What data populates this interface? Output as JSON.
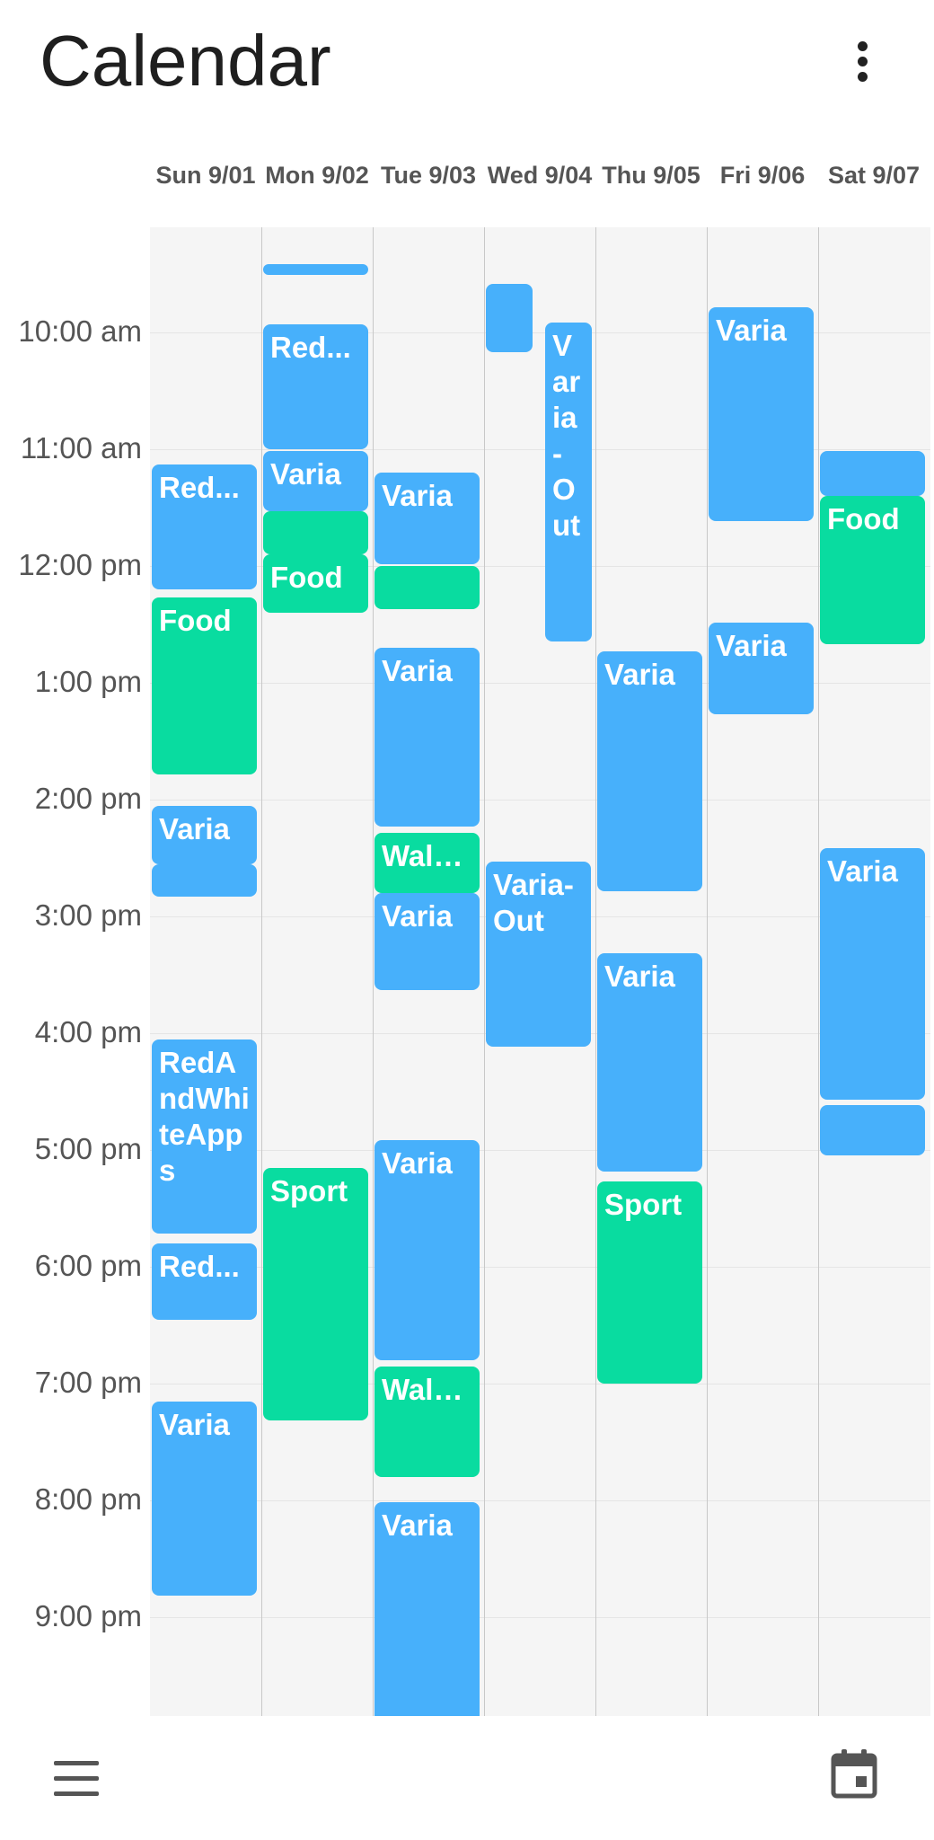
{
  "app": {
    "title": "Calendar"
  },
  "days": [
    "Sun 9/01",
    "Mon 9/02",
    "Tue 9/03",
    "Wed 9/04",
    "Thu 9/05",
    "Fri 9/06",
    "Sat 9/07"
  ],
  "times": [
    "10:00 am",
    "11:00 am",
    "12:00 pm",
    "1:00 pm",
    "2:00 pm",
    "3:00 pm",
    "4:00 pm",
    "5:00 pm",
    "6:00 pm",
    "7:00 pm",
    "8:00 pm",
    "9:00 pm",
    "10:00 pm"
  ],
  "colors": {
    "varia": "#47b0fb",
    "green": "#09dca0"
  },
  "events": [
    {
      "day": 0,
      "start": "11:08",
      "end": "12:12",
      "label": "Red...",
      "kind": "varia"
    },
    {
      "day": 0,
      "start": "12:16",
      "end": "13:47",
      "label": "Food",
      "kind": "green"
    },
    {
      "day": 0,
      "start": "14:03",
      "end": "14:33",
      "label": "Varia",
      "kind": "varia"
    },
    {
      "day": 0,
      "start": "14:33",
      "end": "14:50",
      "label": "",
      "kind": "varia"
    },
    {
      "day": 0,
      "start": "16:03",
      "end": "17:43",
      "label": "RedAndWhiteApps",
      "kind": "varia"
    },
    {
      "day": 0,
      "start": "17:48",
      "end": "18:27",
      "label": "Red...",
      "kind": "varia"
    },
    {
      "day": 0,
      "start": "19:09",
      "end": "20:49",
      "label": "Varia",
      "kind": "varia"
    },
    {
      "day": 1,
      "start": "09:25",
      "end": "09:28",
      "label": "",
      "kind": "varia"
    },
    {
      "day": 1,
      "start": "09:56",
      "end": "11:00",
      "label": "Red...",
      "kind": "varia"
    },
    {
      "day": 1,
      "start": "11:01",
      "end": "11:32",
      "label": "Varia",
      "kind": "varia"
    },
    {
      "day": 1,
      "start": "11:32",
      "end": "11:54",
      "label": "",
      "kind": "green"
    },
    {
      "day": 1,
      "start": "11:54",
      "end": "12:24",
      "label": "Food",
      "kind": "green"
    },
    {
      "day": 1,
      "start": "17:09",
      "end": "19:19",
      "label": "Sport",
      "kind": "green"
    },
    {
      "day": 2,
      "start": "11:12",
      "end": "11:59",
      "label": "Varia",
      "kind": "varia"
    },
    {
      "day": 2,
      "start": "12:00",
      "end": "12:22",
      "label": "",
      "kind": "green"
    },
    {
      "day": 2,
      "start": "12:42",
      "end": "14:14",
      "label": "Varia",
      "kind": "varia"
    },
    {
      "day": 2,
      "start": "14:17",
      "end": "14:48",
      "label": "Walk...",
      "kind": "green"
    },
    {
      "day": 2,
      "start": "14:48",
      "end": "15:38",
      "label": "Varia",
      "kind": "varia"
    },
    {
      "day": 2,
      "start": "16:55",
      "end": "18:48",
      "label": "Varia",
      "kind": "varia"
    },
    {
      "day": 2,
      "start": "18:51",
      "end": "19:48",
      "label": "Walking",
      "kind": "green"
    },
    {
      "day": 2,
      "start": "20:01",
      "end": "21:56",
      "label": "Varia",
      "kind": "varia"
    },
    {
      "day": 3,
      "start": "09:35",
      "end": "10:10",
      "label": "",
      "kind": "varia"
    },
    {
      "day": 3,
      "start": "09:55",
      "end": "12:39",
      "label": "Varia-Out",
      "kind": "varia"
    },
    {
      "day": 3,
      "start": "14:32",
      "end": "16:07",
      "label": "Varia-Out",
      "kind": "varia"
    },
    {
      "day": 4,
      "start": "12:44",
      "end": "14:47",
      "label": "Varia",
      "kind": "varia"
    },
    {
      "day": 4,
      "start": "15:19",
      "end": "17:11",
      "label": "Varia",
      "kind": "varia"
    },
    {
      "day": 4,
      "start": "17:16",
      "end": "19:00",
      "label": "Sport",
      "kind": "green"
    },
    {
      "day": 5,
      "start": "09:47",
      "end": "11:37",
      "label": "Varia",
      "kind": "varia"
    },
    {
      "day": 5,
      "start": "12:29",
      "end": "13:16",
      "label": "Varia",
      "kind": "varia"
    },
    {
      "day": 6,
      "start": "11:01",
      "end": "11:24",
      "label": "",
      "kind": "varia"
    },
    {
      "day": 6,
      "start": "11:24",
      "end": "12:40",
      "label": "Food",
      "kind": "green"
    },
    {
      "day": 6,
      "start": "14:25",
      "end": "16:34",
      "label": "Varia",
      "kind": "varia"
    },
    {
      "day": 6,
      "start": "16:37",
      "end": "17:03",
      "label": "",
      "kind": "varia"
    }
  ],
  "icons": {
    "menu": "more-vert-icon",
    "nav": "hamburger-icon",
    "today": "calendar-icon"
  }
}
